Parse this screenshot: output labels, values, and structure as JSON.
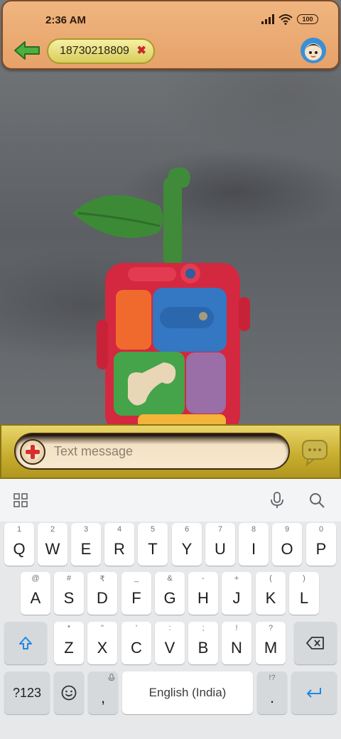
{
  "status_bar": {
    "time": "2:36 AM",
    "battery": "100"
  },
  "header": {
    "contact_number": "18730218809",
    "remove_symbol": "✖"
  },
  "compose": {
    "placeholder": "Text message"
  },
  "keyboard": {
    "row1": [
      {
        "hint": "1",
        "key": "Q"
      },
      {
        "hint": "2",
        "key": "W"
      },
      {
        "hint": "3",
        "key": "E"
      },
      {
        "hint": "4",
        "key": "R"
      },
      {
        "hint": "5",
        "key": "T"
      },
      {
        "hint": "6",
        "key": "Y"
      },
      {
        "hint": "7",
        "key": "U"
      },
      {
        "hint": "8",
        "key": "I"
      },
      {
        "hint": "9",
        "key": "O"
      },
      {
        "hint": "0",
        "key": "P"
      }
    ],
    "row2": [
      {
        "hint": "@",
        "key": "A"
      },
      {
        "hint": "#",
        "key": "S"
      },
      {
        "hint": "₹",
        "key": "D"
      },
      {
        "hint": "_",
        "key": "F"
      },
      {
        "hint": "&",
        "key": "G"
      },
      {
        "hint": "-",
        "key": "H"
      },
      {
        "hint": "+",
        "key": "J"
      },
      {
        "hint": "(",
        "key": "K"
      },
      {
        "hint": ")",
        "key": "L"
      }
    ],
    "row3": [
      {
        "hint": "*",
        "key": "Z"
      },
      {
        "hint": "\"",
        "key": "X"
      },
      {
        "hint": "'",
        "key": "C"
      },
      {
        "hint": ":",
        "key": "V"
      },
      {
        "hint": ";",
        "key": "B"
      },
      {
        "hint": "!",
        "key": "N"
      },
      {
        "hint": "?",
        "key": "M"
      }
    ],
    "symbols_key": "?123",
    "comma_key": ",",
    "space_label": "English (India)",
    "period_hint": "!?",
    "period_key": "."
  },
  "colors": {
    "header": "#e9a86f",
    "compose_bar": "#c6ac2d",
    "accent_blue": "#1e88e5"
  },
  "icons": [
    "back-arrow-icon",
    "close-icon",
    "avatar-icon",
    "add-icon",
    "send-message-icon",
    "grid-icon",
    "microphone-icon",
    "search-icon",
    "shift-icon",
    "backspace-icon",
    "emoji-icon",
    "enter-icon"
  ]
}
